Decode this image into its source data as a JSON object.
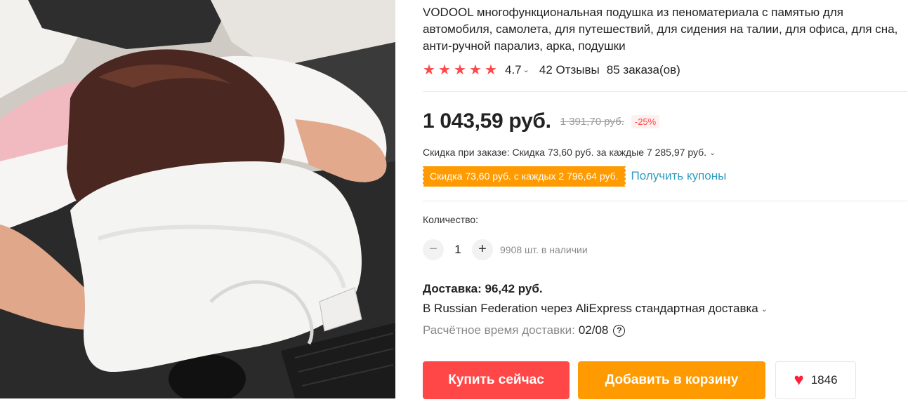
{
  "product": {
    "title": "VODOOL многофункциональная подушка из пеноматериала с памятью для автомобиля, самолета, для путешествий, для сидения на талии, для офиса, для сна, анти-ручной парализ, арка, подушки",
    "image_alt": "Woman sleeping on a white memory foam pillow at a desk"
  },
  "rating": {
    "value": "4.7",
    "stars": 5,
    "star_glyph": "★",
    "chevron": "⌄",
    "reviews": "42 Отзывы",
    "orders": "85 заказа(ов)"
  },
  "price": {
    "current": "1 043,59 руб.",
    "old": "1 391,70 руб.",
    "discount": "-25%"
  },
  "order_discount": {
    "text": "Скидка при заказе: Скидка 73,60 руб. за каждые 7 285,97 руб."
  },
  "coupon": {
    "tag": "Скидка 73,60 руб. с каждых 2 796,64 руб.",
    "link": "Получить купоны"
  },
  "quantity": {
    "label": "Количество:",
    "minus": "−",
    "plus": "+",
    "value": "1",
    "stock": "9908 шт. в наличии"
  },
  "delivery": {
    "price": "Доставка: 96,42 руб.",
    "method": "В Russian Federation через AliExpress стандартная доставка",
    "time_label": "Расчётное время доставки:",
    "time_value": "02/08",
    "help_icon": "?"
  },
  "actions": {
    "buy": "Купить сейчас",
    "cart": "Добавить в корзину",
    "wishlist_count": "1846",
    "heart_glyph": "♥"
  },
  "colors": {
    "accent_red": "#ff4747",
    "accent_orange": "#ff9a00",
    "link_blue": "#2e9cc3"
  }
}
